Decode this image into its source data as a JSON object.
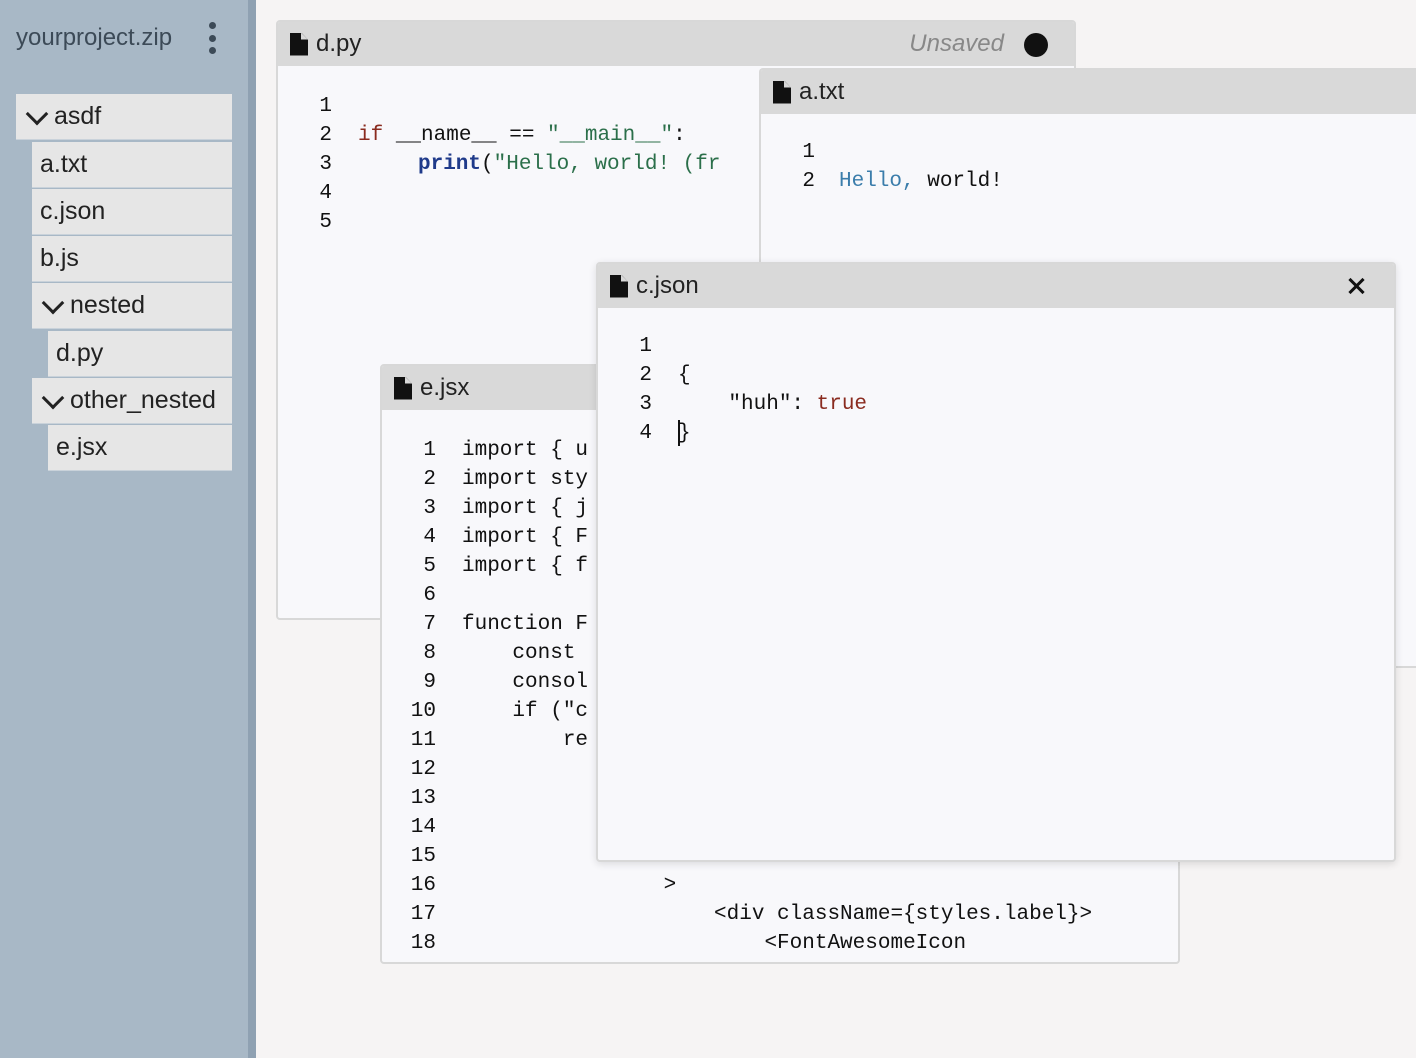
{
  "sidebar": {
    "project_name": "yourproject.zip",
    "menu_icon": "kebab-icon",
    "tree": [
      {
        "label": "asdf",
        "type": "folder",
        "expanded": true
      },
      {
        "label": "a.txt",
        "type": "file"
      },
      {
        "label": "c.json",
        "type": "file"
      },
      {
        "label": "b.js",
        "type": "file"
      },
      {
        "label": "nested",
        "type": "folder",
        "expanded": true
      },
      {
        "label": "d.py",
        "type": "file"
      },
      {
        "label": "other_nested",
        "type": "folder",
        "expanded": true
      },
      {
        "label": "e.jsx",
        "type": "file"
      }
    ]
  },
  "windows": {
    "dpy": {
      "title": "d.py",
      "status": "Unsaved",
      "line_numbers": [
        "1",
        "2",
        "3",
        "4",
        "5"
      ],
      "lines": [
        {
          "kw": "if",
          "rest": " __name__ == ",
          "str": "\"__main__\"",
          "tail": ":"
        },
        {
          "fn": "print",
          "rest": "(",
          "str": "\"Hello, world! (fr"
        }
      ]
    },
    "atxt": {
      "title": "a.txt",
      "line_numbers": [
        "1",
        "2"
      ],
      "lines": [
        {
          "blue": "Hello,",
          "rest": " world!"
        }
      ]
    },
    "ejsx": {
      "title": "e.jsx",
      "line_numbers": [
        "1",
        "2",
        "3",
        "4",
        "5",
        "6",
        "7",
        "8",
        "9",
        "10",
        "11",
        "12",
        "13",
        "14",
        "15",
        "16",
        "17",
        "18"
      ],
      "lines": [
        "import { u",
        "import sty",
        "import { j",
        "import { F",
        "import { f",
        "",
        "function F",
        "    const ",
        "    consol",
        "    if (\"c",
        "        re",
        "",
        "",
        "",
        "",
        "                >",
        "                    <div className={styles.label}>",
        "                        <FontAwesomeIcon"
      ]
    },
    "cjson": {
      "title": "c.json",
      "line_numbers": [
        "1",
        "2",
        "3",
        "4"
      ],
      "lines": [
        {
          "text": "{"
        },
        {
          "key": "    \"huh\": ",
          "bool": "true"
        },
        {
          "text": "}"
        },
        {
          "text": ""
        }
      ]
    }
  },
  "colors": {
    "sidebar": "#a8b8c6",
    "header": "#d9d9d9",
    "keyword": "#8a2b1f",
    "string": "#2b6f4a",
    "function": "#1f3a8a"
  }
}
